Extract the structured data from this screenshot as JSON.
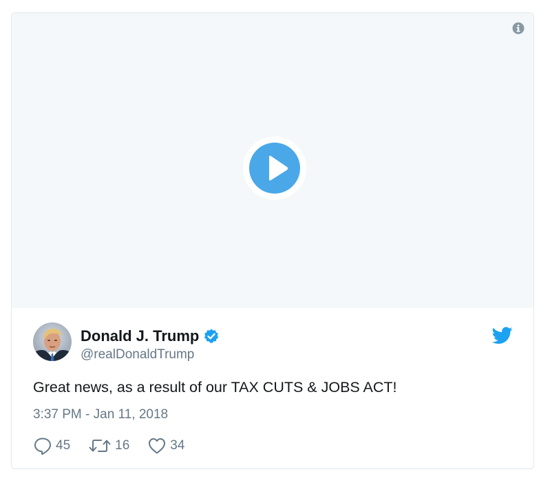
{
  "media": {
    "info_icon": "info-icon",
    "play_icon": "play-icon",
    "background": "#f5f8fa",
    "accent": "#4aa8e8"
  },
  "tweet": {
    "display_name": "Donald J. Trump",
    "handle": "@realDonaldTrump",
    "verified": true,
    "text": "Great news, as a result of our TAX CUTS & JOBS ACT!",
    "timestamp": "3:37 PM - Jan 11, 2018",
    "actions": {
      "reply": {
        "icon": "reply-icon",
        "count": "45"
      },
      "retweet": {
        "icon": "retweet-icon",
        "count": "16"
      },
      "like": {
        "icon": "heart-icon",
        "count": "34"
      }
    },
    "brand_icon": "twitter-bird-icon",
    "brand_color": "#1da1f2",
    "text_color": "#14171a",
    "muted_color": "#657786"
  }
}
